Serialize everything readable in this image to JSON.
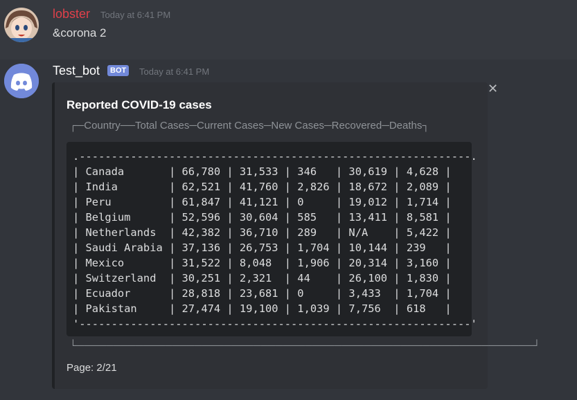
{
  "messages": [
    {
      "author": "lobster",
      "author_color": "#e0404a",
      "timestamp": "Today at 6:41 PM",
      "content": "&corona 2",
      "avatar": "anime-avatar-icon"
    },
    {
      "author": "Test_bot",
      "bot_tag": "BOT",
      "timestamp": "Today at 6:41 PM",
      "avatar": "discord-logo-icon",
      "embed": {
        "title": "Reported COVID-19 cases",
        "header_line": "┌─Country──Total Cases─Current Cases─New Cases─Recovered─Deaths┐",
        "table": {
          "top_edge": ".-------------------------------------------------------------.",
          "bottom_edge": "'-------------------------------------------------------------'",
          "rows": [
            "| Canada       | 66,780 | 31,533 | 346   | 30,619 | 4,628 |",
            "| India        | 62,521 | 41,760 | 2,826 | 18,672 | 2,089 |",
            "| Peru         | 61,847 | 41,121 | 0     | 19,012 | 1,714 |",
            "| Belgium      | 52,596 | 30,604 | 585   | 13,411 | 8,581 |",
            "| Netherlands  | 42,382 | 36,710 | 289   | N/A    | 5,422 |",
            "| Saudi Arabia | 37,136 | 26,753 | 1,704 | 10,144 | 239   |",
            "| Mexico       | 31,522 | 8,048  | 1,906 | 20,314 | 3,160 |",
            "| Switzerland  | 30,251 | 2,321  | 44    | 26,100 | 1,830 |",
            "| Ecuador      | 28,818 | 23,681 | 0     | 3,433  | 1,704 |",
            "| Pakistan     | 27,474 | 19,100 | 1,039 | 7,756  | 618   |"
          ]
        },
        "footer_line": "└──────────────────────────────────────────────────────────────┘",
        "page": "Page: 2/21",
        "close_icon": "close-icon"
      }
    }
  ]
}
